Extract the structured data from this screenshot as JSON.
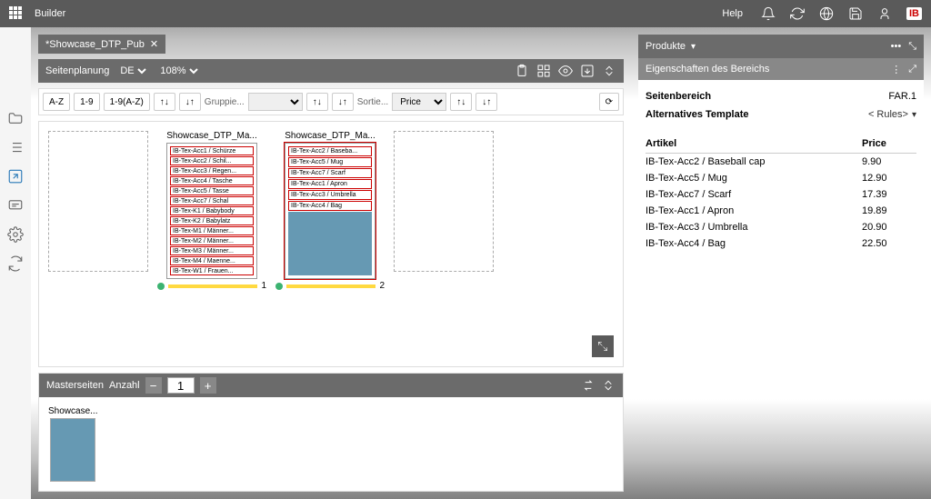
{
  "header": {
    "app": "Builder",
    "help": "Help"
  },
  "tab": {
    "title": "*Showcase_DTP_Pub"
  },
  "planning": {
    "title": "Seitenplanung",
    "lang": "DE",
    "zoom": "108%",
    "sorts": {
      "az": "A-Z",
      "nums": "1-9",
      "mixed": "1-9(A-Z)"
    },
    "group_label": "Gruppie...",
    "sort_label": "Sortie...",
    "sort_field": "Price"
  },
  "pages": [
    {
      "title": "Showcase_DTP_Ma...",
      "num": "1",
      "items": [
        "IB-Tex-Acc1 / Schürze",
        "IB-Tex-Acc2 / Schil...",
        "IB-Tex-Acc3 / Regen...",
        "IB-Tex-Acc4 / Tasche",
        "IB-Tex-Acc5 / Tasse",
        "IB-Tex-Acc7 / Schal",
        "IB-Tex-K1 / Babybody",
        "IB-Tex-K2 / Babylatz",
        "IB-Tex-M1 / Männer...",
        "IB-Tex-M2 / Männer...",
        "IB-Tex-M3 / Männer...",
        "IB-Tex-M4 / Maenne...",
        "IB-Tex-W1 / Frauen..."
      ]
    },
    {
      "title": "Showcase_DTP_Ma...",
      "num": "2",
      "selected": true,
      "items": [
        "IB-Tex-Acc2 / Baseba...",
        "IB-Tex-Acc5 / Mug",
        "IB-Tex-Acc7 / Scarf",
        "IB-Tex-Acc1 / Apron",
        "IB-Tex-Acc3 / Umbrella",
        "IB-Tex-Acc4 / Bag"
      ],
      "fill": true
    }
  ],
  "masters": {
    "title": "Masterseiten",
    "count_label": "Anzahl",
    "count": "1",
    "item": "Showcase..."
  },
  "products": {
    "title": "Produkte",
    "props_title": "Eigenschaften des Bereichs",
    "section_label": "Seitenbereich",
    "section_value": "FAR.1",
    "template_label": "Alternatives Template",
    "template_value": "< Rules>",
    "col1": "Artikel",
    "col2": "Price",
    "rows": [
      {
        "a": "IB-Tex-Acc2 / Baseball cap",
        "p": "9.90"
      },
      {
        "a": "IB-Tex-Acc5 / Mug",
        "p": "12.90"
      },
      {
        "a": "IB-Tex-Acc7 / Scarf",
        "p": "17.39"
      },
      {
        "a": "IB-Tex-Acc1 / Apron",
        "p": "19.89"
      },
      {
        "a": "IB-Tex-Acc3 / Umbrella",
        "p": "20.90"
      },
      {
        "a": "IB-Tex-Acc4 / Bag",
        "p": "22.50"
      }
    ]
  }
}
